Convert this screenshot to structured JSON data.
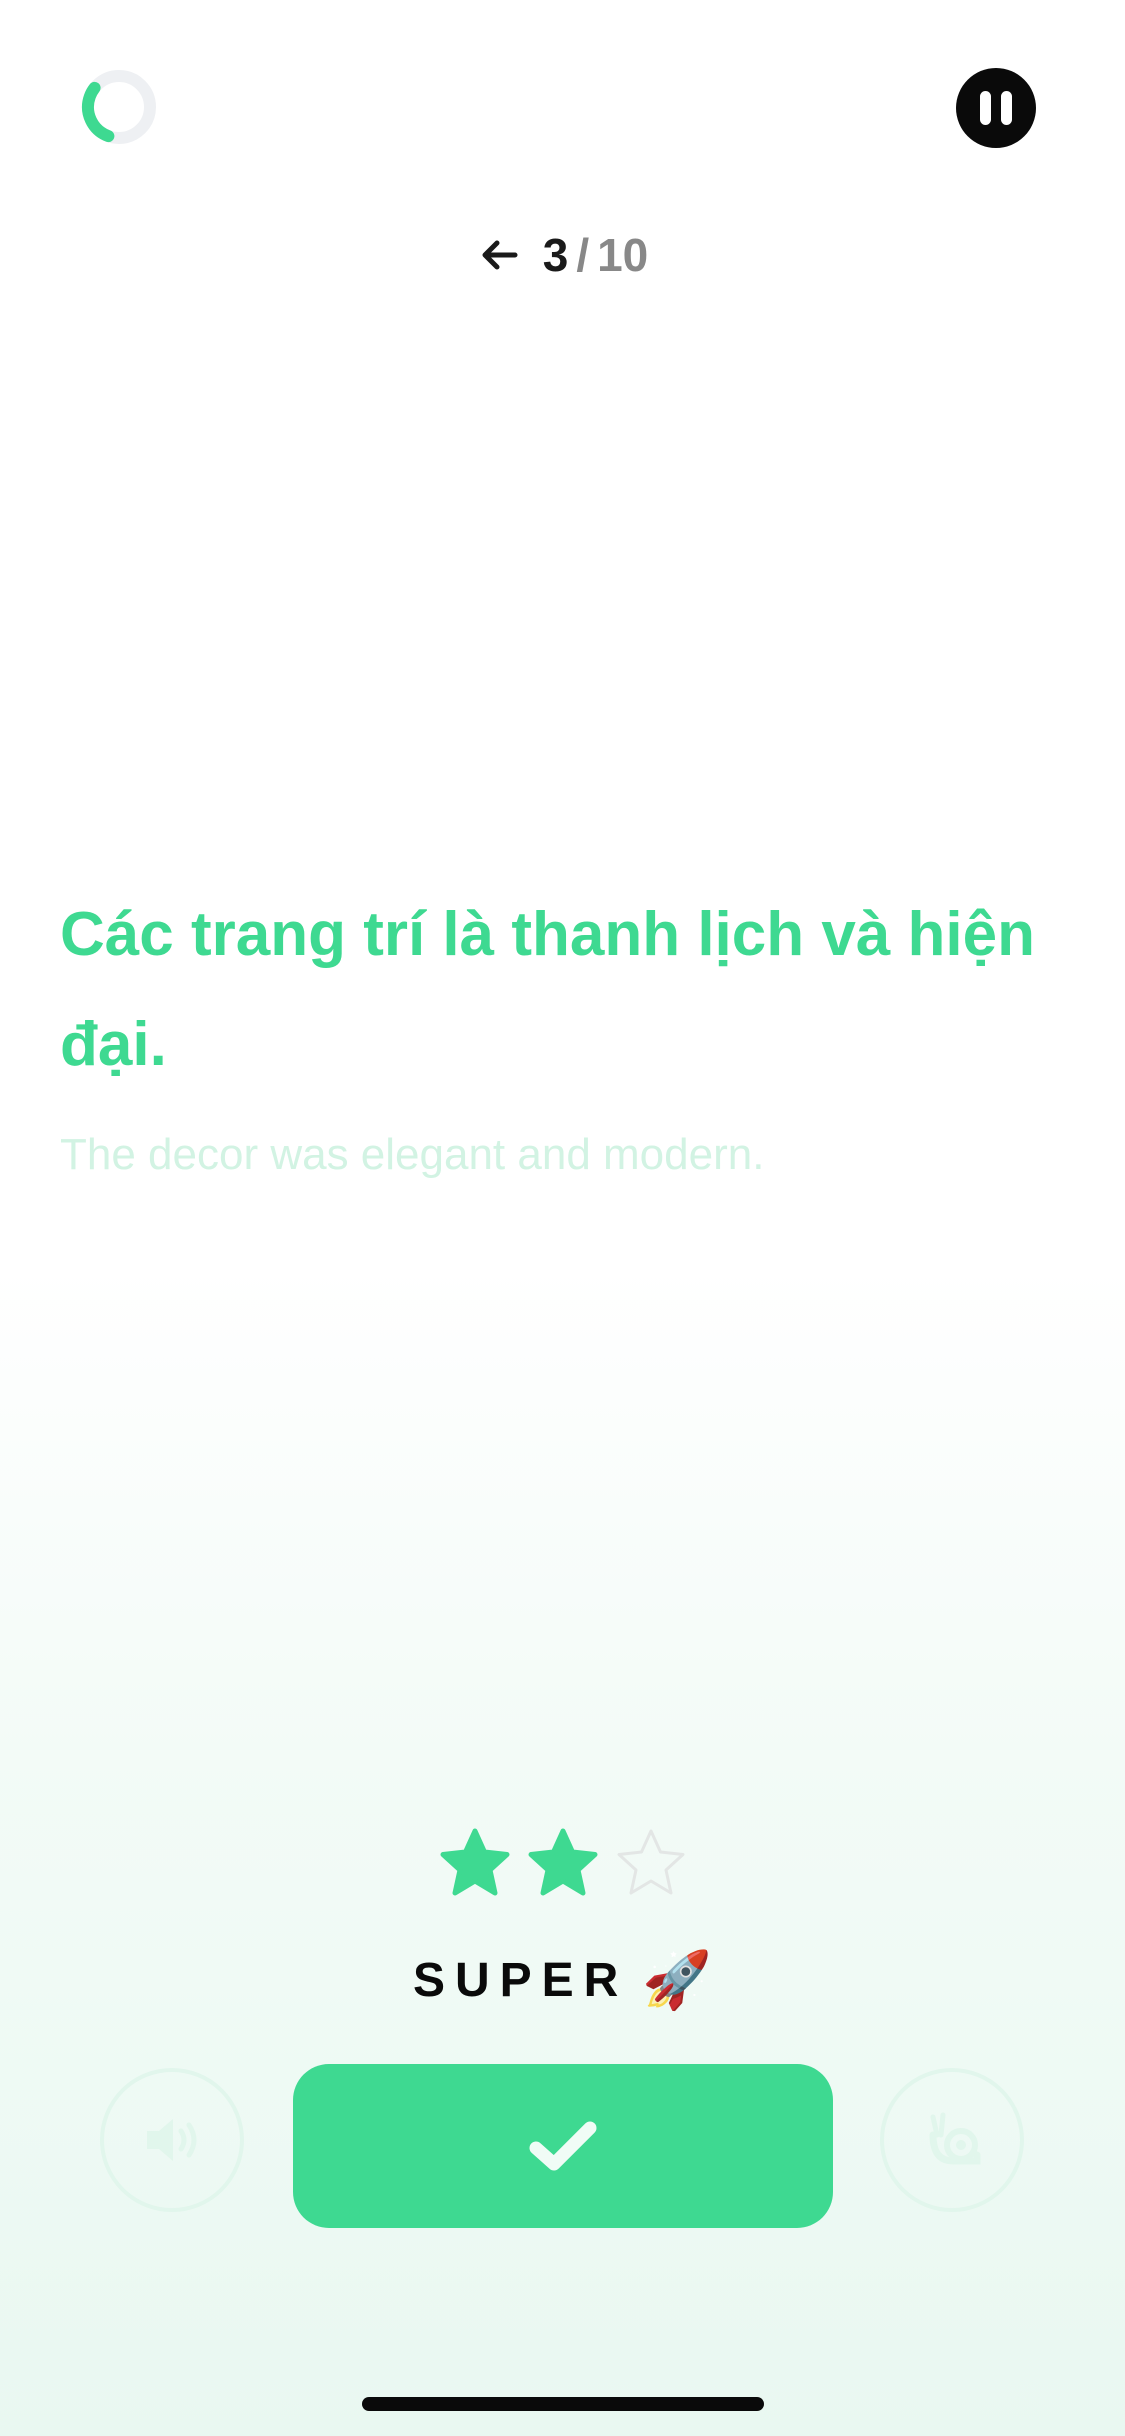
{
  "header": {
    "progress": 0.3,
    "pause_icon": "pause-icon",
    "back_icon": "arrow-left-icon"
  },
  "counter": {
    "current": "3",
    "separator": "/",
    "total": "10"
  },
  "exercise": {
    "sentence": "Các trang trí là thanh lịch và hiện đại.",
    "translation": "The decor was elegant and modern."
  },
  "rating": {
    "stars_filled": 2,
    "stars_total": 3,
    "label": "SUPER",
    "emoji": "🚀"
  },
  "controls": {
    "speaker_icon": "speaker-icon",
    "check_icon": "check-icon",
    "slow_icon": "snail-icon"
  },
  "colors": {
    "accent": "#3ed991",
    "accent_faint": "#d2f3e3",
    "dark": "#0a0a0a",
    "muted": "#888888"
  }
}
